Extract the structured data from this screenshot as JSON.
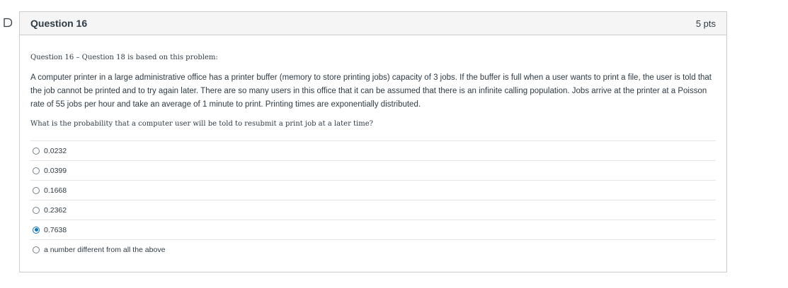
{
  "question": {
    "title": "Question 16",
    "points": "5 pts",
    "intro": "Question 16 – Question 18 is based on this problem:",
    "problem": "A computer printer in a large administrative office has a printer buffer (memory to store printing jobs) capacity of 3 jobs. If the buffer is full when a user wants to print a file, the user is told that the job cannot be printed and to try again later. There are so many users in this office that it can be assumed that there is an infinite calling population. Jobs arrive at the printer at a Poisson rate of 55 jobs per hour and take an average of 1 minute to print. Printing times are exponentially distributed.",
    "prompt": "What is the probability that a computer user will be told to resubmit a print job at a later time?",
    "answers": [
      {
        "label": "0.0232",
        "selected": false
      },
      {
        "label": "0.0399",
        "selected": false
      },
      {
        "label": "0.1668",
        "selected": false
      },
      {
        "label": "0.2362",
        "selected": false
      },
      {
        "label": "0.7638",
        "selected": true
      },
      {
        "label": "a number different from all the above",
        "selected": false
      }
    ]
  },
  "icons": {
    "flag": "flag-outline-icon"
  },
  "colors": {
    "accent": "#0a74c9",
    "border": "#c7cdd1",
    "header_bg": "#f5f5f5",
    "text": "#2d3b45"
  }
}
